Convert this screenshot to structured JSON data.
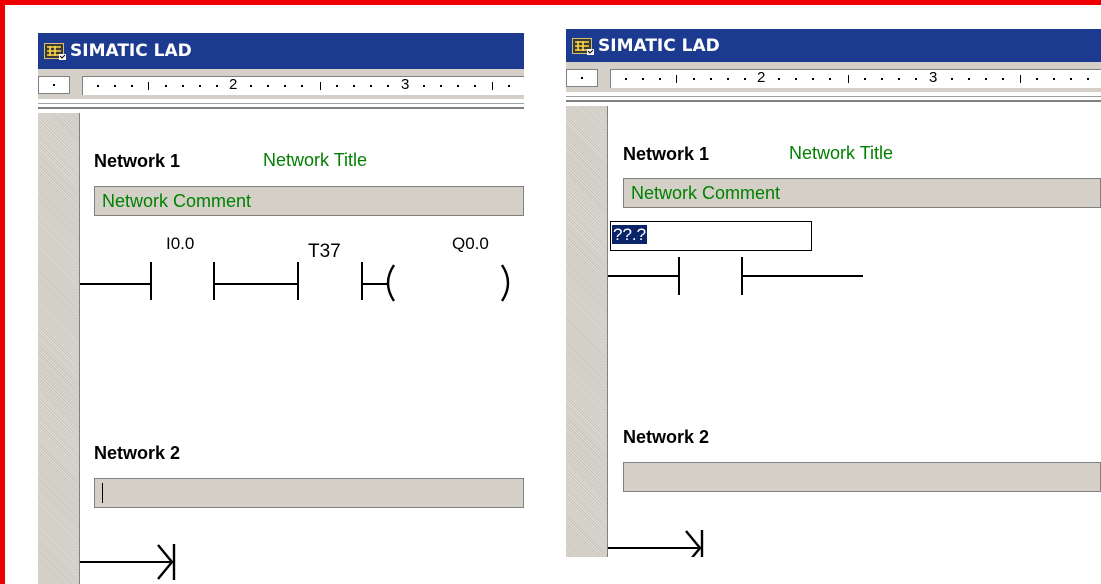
{
  "windows": [
    {
      "title": "SIMATIC LAD",
      "ruler": {
        "numbers": [
          "2",
          "3"
        ]
      },
      "network1": {
        "label": "Network 1",
        "title": "Network Title",
        "comment": "Network Comment",
        "contact1_address": "I0.0",
        "contact2_address": "T37",
        "coil_address": "Q0.0"
      },
      "network2": {
        "label": "Network 2",
        "comment": ""
      }
    },
    {
      "title": "SIMATIC LAD",
      "ruler": {
        "numbers": [
          "2",
          "3"
        ]
      },
      "network1": {
        "label": "Network 1",
        "title": "Network Title",
        "comment": "Network Comment",
        "contact_address_placeholder": "??.?"
      },
      "network2": {
        "label": "Network 2",
        "comment": ""
      }
    }
  ],
  "colors": {
    "titlebar": "#1c3a8f",
    "comment_text": "#008000",
    "frame_border": "#ee0000",
    "selection": "#0a246a"
  },
  "icons": {
    "app": "simatic-ladder-icon",
    "network_end": "network-end-arrow-icon"
  }
}
